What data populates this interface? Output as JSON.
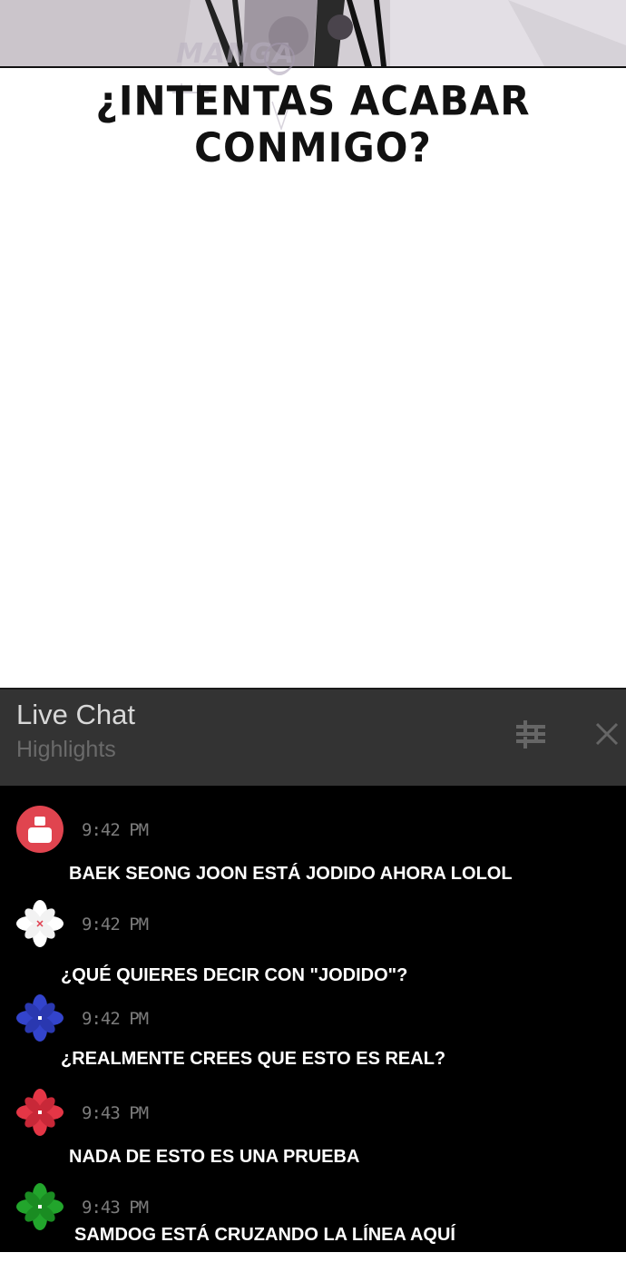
{
  "watermark": {
    "text": "MANGA"
  },
  "panel": {
    "caption": "¿INTENTAS ACABAR CONMIGO?"
  },
  "chat": {
    "title": "Live Chat",
    "subtitle": "Highlights",
    "filter_icon": "sliders-icon",
    "close_icon": "close-icon",
    "messages": [
      {
        "avatar": "red-circle-avatar",
        "time": "9:42 PM",
        "text": "BAEK SEONG JOON ESTÁ JODIDO AHORA LOLOL"
      },
      {
        "avatar": "white-flower-avatar",
        "time": "9:42 PM",
        "text": "¿QUÉ QUIERES DECIR CON \"JODIDO\"?"
      },
      {
        "avatar": "blue-flower-avatar",
        "time": "9:42 PM",
        "text": "¿REALMENTE CREES QUE ESTO ES REAL?"
      },
      {
        "avatar": "red-flower-avatar",
        "time": "9:43 PM",
        "text": "NADA DE ESTO ES UNA PRUEBA"
      },
      {
        "avatar": "green-flower-avatar",
        "time": "9:43 PM",
        "text": "SAMDOG ESTÁ CRUZANDO LA LÍNEA AQUÍ"
      }
    ]
  },
  "colors": {
    "header_bg": "#333333",
    "chat_bg": "#000000",
    "avatar_red": "#e0444f",
    "flower_white": "#ffffff",
    "flower_blue": "#3344cc",
    "flower_red": "#e43646",
    "flower_green": "#22a52c"
  }
}
